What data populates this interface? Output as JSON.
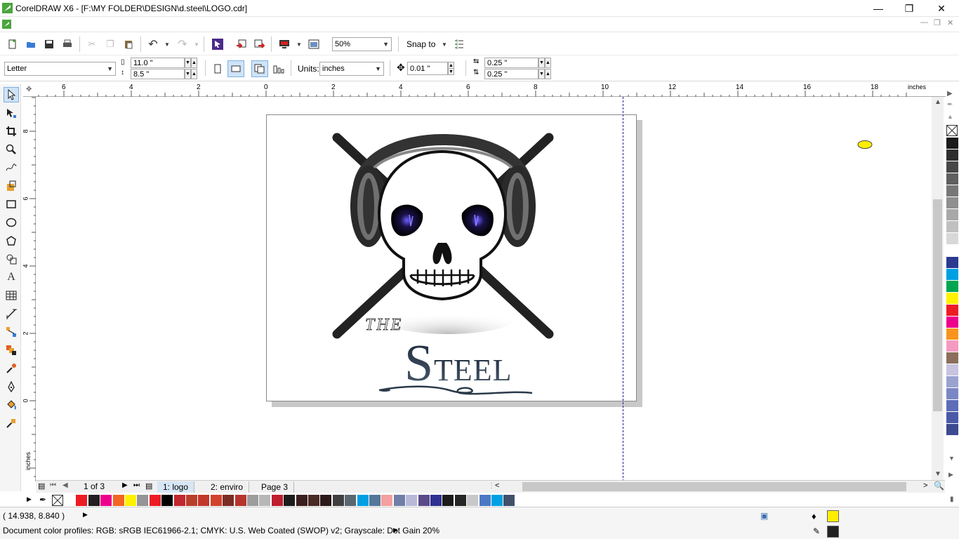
{
  "window": {
    "title": "CorelDRAW X6 - [F:\\MY FOLDER\\DESIGN\\d.steel\\LOGO.cdr]",
    "minimize": "—",
    "restore": "❐",
    "close": "✕"
  },
  "toolbar": {
    "zoom_value": "50%",
    "snap_to": "Snap to"
  },
  "property_bar": {
    "paper_size": "Letter",
    "width": "11.0 \"",
    "height": "8.5 \"",
    "units_label": "Units:",
    "units_value": "inches",
    "nudge": "0.01 \"",
    "dup_x": "0.25 \"",
    "dup_y": "0.25 \""
  },
  "rulers": {
    "h_labels": [
      "6",
      "4",
      "2",
      "0",
      "2",
      "4",
      "6",
      "8",
      "10",
      "12",
      "14",
      "16",
      "18"
    ],
    "h_unit": "inches",
    "v_labels": [
      "8",
      "6",
      "4",
      "2",
      "0"
    ],
    "v_unit": "inches"
  },
  "artwork": {
    "text_the": "THE",
    "text_s": "S",
    "text_teel": "TEEL"
  },
  "doc_nav": {
    "page_count": "1 of 3",
    "tabs": [
      "1: logo",
      "2: enviro",
      "Page 3"
    ]
  },
  "status": {
    "coords": "( 14.938, 8.840 )",
    "color_profiles": "Document color profiles: RGB: sRGB IEC61966-2.1; CMYK: U.S. Web Coated (SWOP) v2; Grayscale: Dot Gain 20%",
    "fill_color": "#ffee00",
    "outline_color": "#222222"
  },
  "palette_colors": [
    "#1a1a1a",
    "#2e2e2e",
    "#474747",
    "#5f5f5f",
    "#777777",
    "#8f8f8f",
    "#a8a8a8",
    "#c0c0c0",
    "#d8d8d8",
    "#ffffff",
    "#2b3990",
    "#00a0e3",
    "#00a651",
    "#fff200",
    "#ed1c24",
    "#ec008c",
    "#f7941d",
    "#f49ac1",
    "#8b6f5c",
    "#c7c3e0",
    "#9aa2d0",
    "#7b87c4",
    "#5d6db8",
    "#4a5aa8",
    "#3d4a8f"
  ],
  "hpalette_colors": [
    "#ffffff",
    "#ed1c24",
    "#231f20",
    "#ec008c",
    "#f26522",
    "#fff200",
    "#939598",
    "#ed1c24",
    "#000000",
    "#c1272d",
    "#b83f2c",
    "#c1392b",
    "#d2432f",
    "#7b2d26",
    "#b5352c",
    "#9d9d9d",
    "#b7b7b7",
    "#be1e2d",
    "#1c1c1c",
    "#3b1f1f",
    "#4a2a25",
    "#2c1a1a",
    "#404040",
    "#5b6770",
    "#00a0e3",
    "#54779a",
    "#f4a0a0",
    "#6f7fa8",
    "#b8b8d8",
    "#5a4a8a",
    "#2e3192",
    "#1b1b1b",
    "#262626",
    "#c8c8c8",
    "#4d79c4",
    "#00a0e3",
    "#41516b"
  ]
}
